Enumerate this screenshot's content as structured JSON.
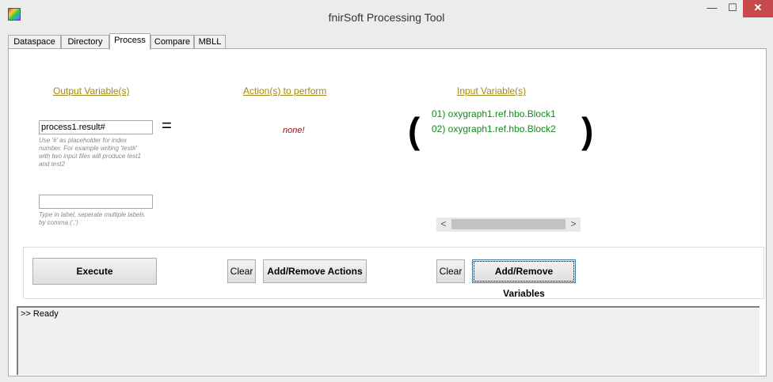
{
  "window": {
    "title": "fnirSoft Processing Tool",
    "minimize_glyph": "—",
    "maximize_glyph": "☐",
    "close_glyph": "✕"
  },
  "tabs": [
    "Dataspace",
    "Directory",
    "Process",
    "Compare",
    "MBLL"
  ],
  "active_tab": "Process",
  "headers": {
    "output": "Output Variable(s)",
    "actions": "Action(s) to perform",
    "input": "Input Variable(s)"
  },
  "output_field": {
    "value": "process1.result#",
    "hint": "Use '#' as placeholder for index number. For example writing 'test#' with two input files will produce test1 and test2"
  },
  "equals": "=",
  "actions_value": "none!",
  "label_field": {
    "value": "",
    "hint": "Type in label, seperate multiple labels by comma (',')"
  },
  "parens": {
    "open": "(",
    "close": ")"
  },
  "input_variables": [
    "01) oxygraph1.ref.hbo.Block1",
    "02) oxygraph1.ref.hbo.Block2"
  ],
  "scrollbar": {
    "left_arrow": "<",
    "right_arrow": ">"
  },
  "buttons": {
    "execute": "Execute",
    "clear_actions": "Clear",
    "add_remove_actions": "Add/Remove Actions",
    "clear_variables": "Clear",
    "add_remove_variables": "Add/Remove Variables"
  },
  "console_text": ">> Ready",
  "colors": {
    "header": "#a28a10",
    "input_variable": "#138a1b",
    "none_text": "#8a1010",
    "close_button": "#c7494b"
  }
}
